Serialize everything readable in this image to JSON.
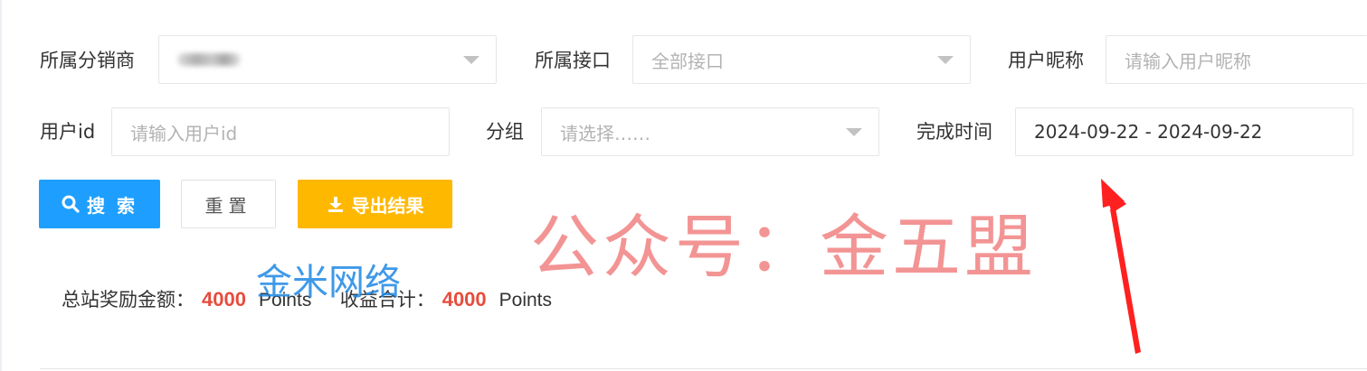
{
  "filters": {
    "distributor": {
      "label": "所属分销商"
    },
    "interface": {
      "label": "所属接口",
      "value": "全部接口"
    },
    "nickname": {
      "label": "用户昵称",
      "placeholder": "请输入用户昵称"
    },
    "userid": {
      "label": "用户id",
      "placeholder": "请输入用户id"
    },
    "group": {
      "label": "分组",
      "placeholder": "请选择……"
    },
    "finish_time": {
      "label": "完成时间",
      "value": "2024-09-22 - 2024-09-22"
    }
  },
  "buttons": {
    "search": "搜 索",
    "reset": "重置",
    "export": "导出结果"
  },
  "summary": {
    "total_label": "总站奖励金额：",
    "total_value": "4000",
    "total_unit": "Points",
    "income_label": "收益合计：",
    "income_value": "4000",
    "income_unit": "Points"
  },
  "watermarks": {
    "red": "公众号：金五盟",
    "blue": "金米网络"
  },
  "colors": {
    "primary": "#1e9fff",
    "warning": "#ffb800",
    "number_red": "#e74c3c",
    "watermark_red": "#f38c8c",
    "watermark_blue": "#1e88e5",
    "arrow_red": "#ff2020"
  }
}
